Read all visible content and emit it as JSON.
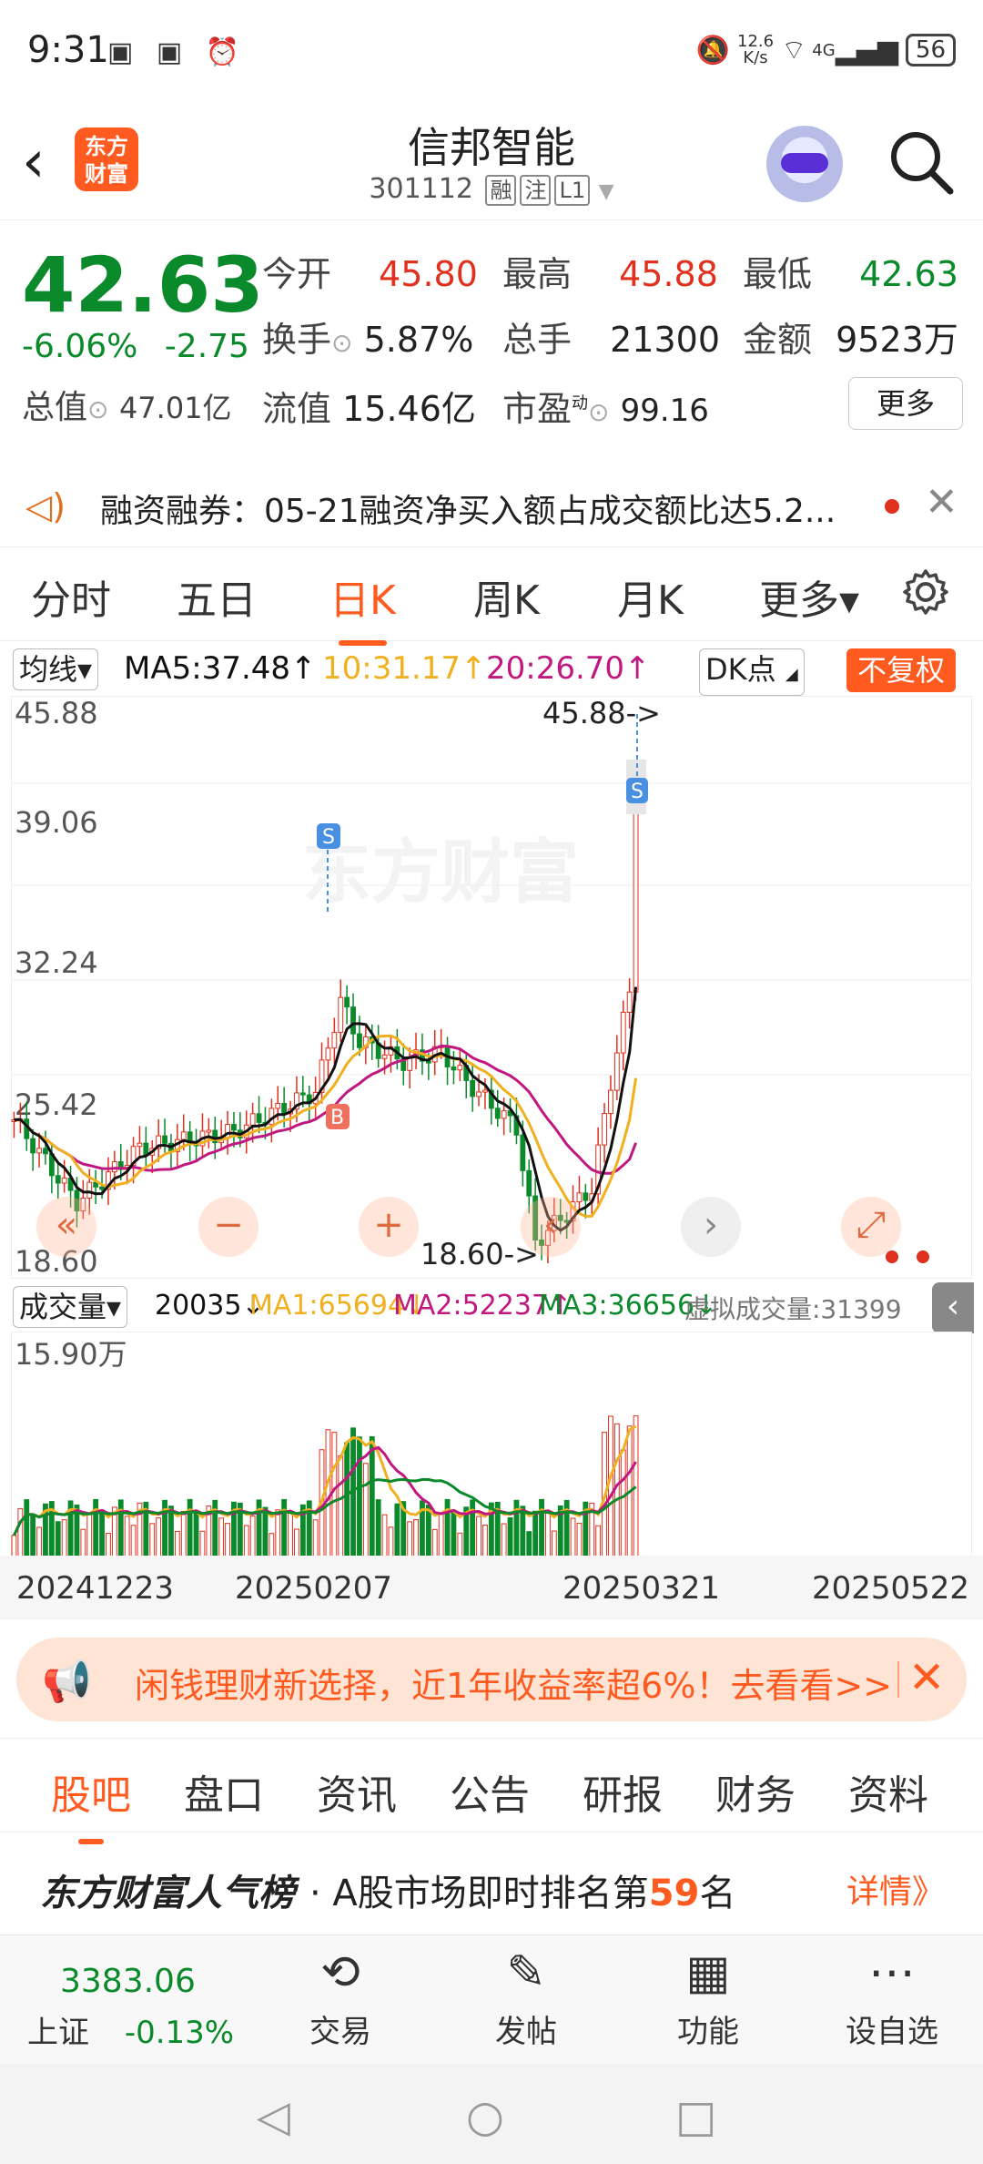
{
  "status_bar": {
    "time": "9:31",
    "net_speed_value": "12.6",
    "net_speed_unit": "K/s",
    "signal": "4G",
    "battery": "56"
  },
  "header": {
    "logo_line1": "东方",
    "logo_line2": "财富",
    "title": "信邦智能",
    "code": "301112",
    "tags": [
      "融",
      "注",
      "L1"
    ]
  },
  "quote": {
    "price": "42.63",
    "change_pct": "-6.06%",
    "change_amt": "-2.75",
    "open_label": "今开",
    "open": "45.80",
    "high_label": "最高",
    "high": "45.88",
    "low_label": "最低",
    "low": "42.63",
    "turnover_label": "换手",
    "turnover": "5.87%",
    "volume_label": "总手",
    "volume": "21300",
    "amount_label": "金额",
    "amount": "9523万",
    "mktcap_label": "总值",
    "mktcap": "47.01亿",
    "float_label": "流值",
    "float_cap": "15.46亿",
    "pe_label": "市盈",
    "pe_sup": "动",
    "pe": "99.16",
    "more_label": "更多"
  },
  "ticker": {
    "text": "融资融券：05-21融资净买入额占成交额比达5.2..."
  },
  "period_tabs": [
    {
      "label": "分时"
    },
    {
      "label": "五日"
    },
    {
      "label": "日K"
    },
    {
      "label": "周K"
    },
    {
      "label": "月K"
    },
    {
      "label": "更多▾"
    }
  ],
  "ma_bar": {
    "ma_select": "均线▾",
    "ma5": "MA5:37.48↑",
    "ma10": "10:31.17↑",
    "ma20": "20:26.70↑",
    "dk": "DK点",
    "fq": "不复权"
  },
  "chart_labels": {
    "y_top": "45.88",
    "y2": "39.06",
    "y3": "32.24",
    "y4": "25.42",
    "y_bottom": "18.60",
    "max_marker": "45.88->",
    "min_marker": "18.60->",
    "watermark": "东方财富",
    "sell_mark": "S",
    "buy_mark": "B"
  },
  "volume_bar": {
    "select": "成交量▾",
    "vol": "20035↓",
    "ma1": "MA1:65694↓",
    "ma2": "MA2:52237↑",
    "ma3": "MA3:36656↓",
    "virtual": "虚拟成交量:31399",
    "y_max": "15.90万"
  },
  "dates": [
    "20241223",
    "20250207",
    "20250321",
    "20250522"
  ],
  "promo": {
    "text": "闲钱理财新选择，近1年收益率超6%！去看看>>"
  },
  "bottom_tabs": [
    {
      "label": "股吧"
    },
    {
      "label": "盘口"
    },
    {
      "label": "资讯"
    },
    {
      "label": "公告"
    },
    {
      "label": "研报"
    },
    {
      "label": "财务"
    },
    {
      "label": "资料"
    }
  ],
  "rank": {
    "brand": "东方财富人气榜",
    "desc_prefix": "· A股市场即时排名第",
    "rank_num": "59",
    "desc_suffix": "名",
    "detail": "详情》"
  },
  "toolbar": {
    "index_value": "3383.06",
    "index_name": "上证",
    "index_change": "-0.13%",
    "trade": "交易",
    "post": "发帖",
    "func": "功能",
    "watch": "设自选"
  },
  "colors": {
    "accent": "#ff5a1f",
    "up": "#e0301e",
    "down": "#0a8a2a",
    "ma5": "#111111",
    "ma10": "#f0b020",
    "ma20": "#c01880"
  }
}
